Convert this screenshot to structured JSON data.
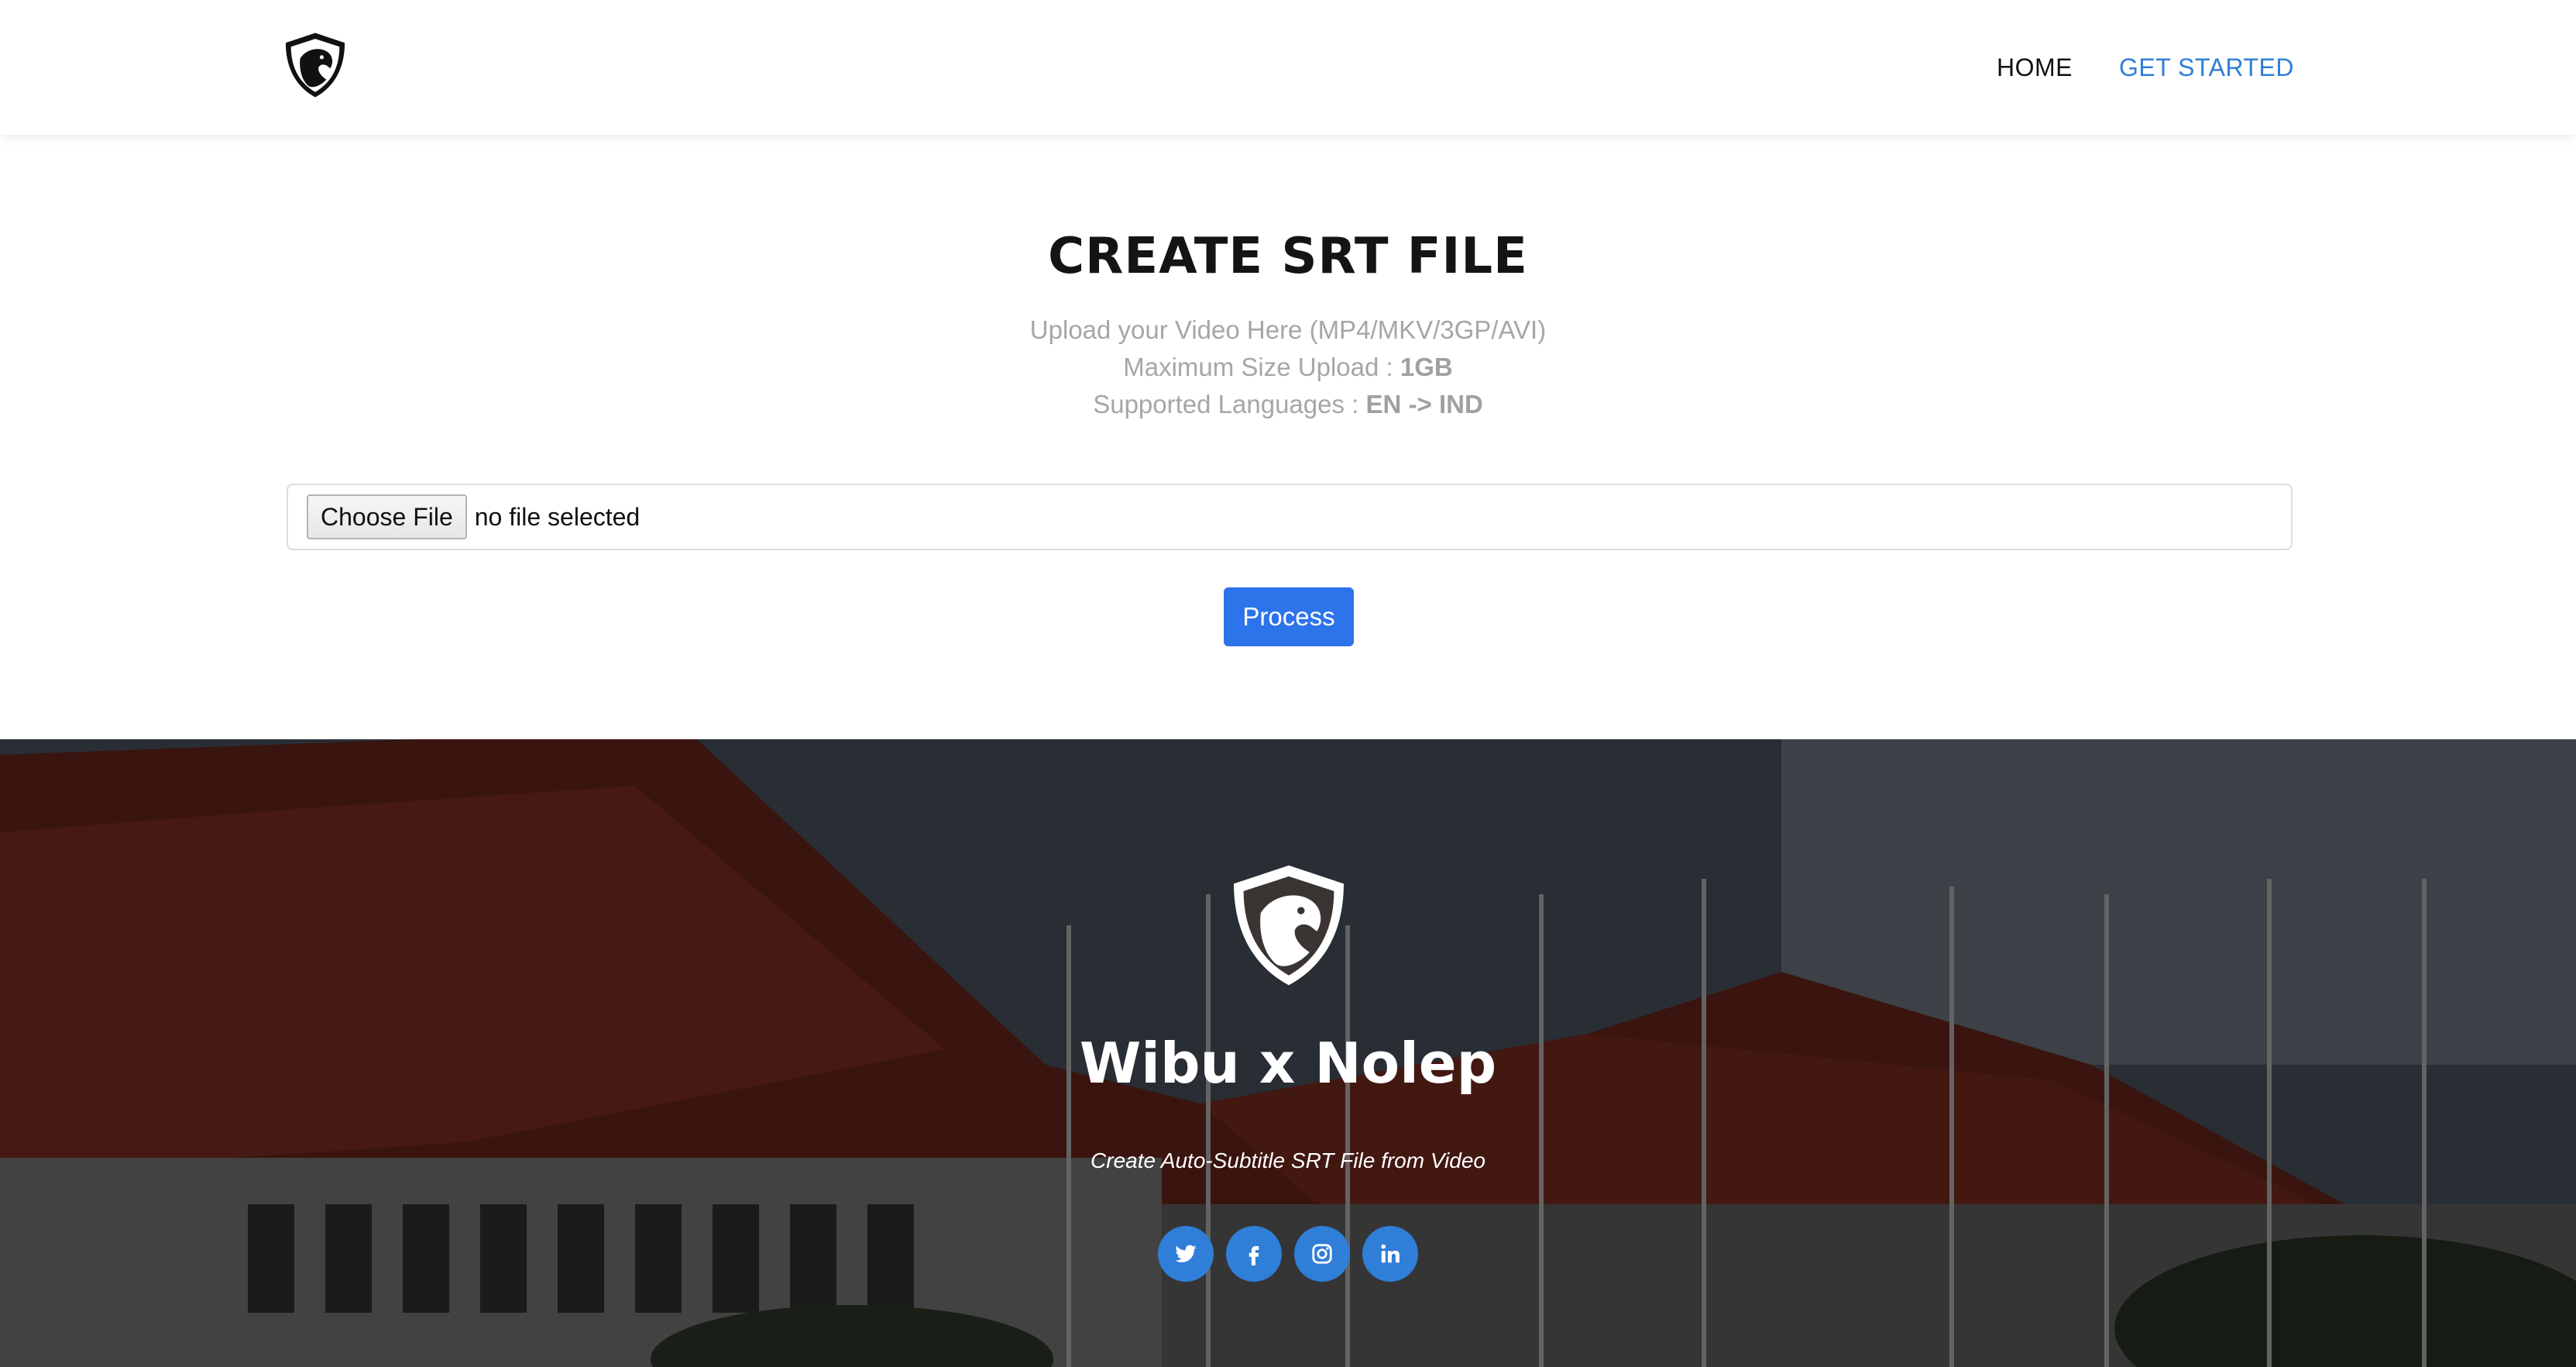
{
  "nav": {
    "logo_icon": "horse-shield-logo",
    "items": [
      {
        "label": "HOME",
        "active": false
      },
      {
        "label": "GET STARTED",
        "active": true
      }
    ]
  },
  "main": {
    "title": "CREATE SRT FILE",
    "upload_hint": "Upload your Video Here (MP4/MKV/3GP/AVI)",
    "max_size_label": "Maximum Size Upload : ",
    "max_size_value": "1GB",
    "languages_label": "Supported Languages : ",
    "languages_value": "EN -> IND",
    "file_input": {
      "button_label": "Choose File",
      "status": "no file selected"
    },
    "process_button": "Process"
  },
  "footer": {
    "logo_icon": "horse-shield-logo",
    "brand": "Wibu x Nolep",
    "tagline": "Create Auto-Subtitle SRT File from Video",
    "socials": [
      {
        "name": "twitter-icon"
      },
      {
        "name": "facebook-icon"
      },
      {
        "name": "instagram-icon"
      },
      {
        "name": "linkedin-icon"
      }
    ]
  },
  "colors": {
    "accent": "#2f7ed8",
    "process_button": "#2d74ea",
    "title": "#141414",
    "muted_text": "#a6a6a6"
  }
}
